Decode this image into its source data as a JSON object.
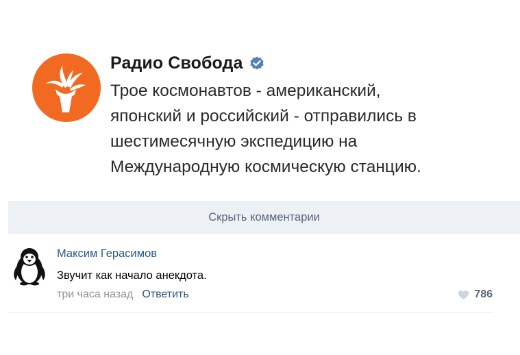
{
  "post": {
    "author": "Радио Свобода",
    "verified_icon": "verified-checkmark-icon",
    "text_lines": [
      "Трое космонавтов - американский,",
      "японский и российский - отправились в",
      "шестимесячную экспедицию на",
      "Международную космическую станцию."
    ],
    "avatar_icon": "radio-liberty-torch-logo",
    "accent_color": "#f26a22"
  },
  "comments_bar": {
    "label": "Скрыть комментарии"
  },
  "comment": {
    "author": "Максим Герасимов",
    "avatar_icon": "penguin-avatar",
    "text": "Звучит как начало анекдота.",
    "time": "три часа назад",
    "reply_label": "Ответить",
    "like_icon": "heart-icon",
    "likes": "786"
  },
  "colors": {
    "link": "#2a5885",
    "verified": "#5181b8",
    "bar_bg": "#edf0f5",
    "muted": "#939393"
  }
}
